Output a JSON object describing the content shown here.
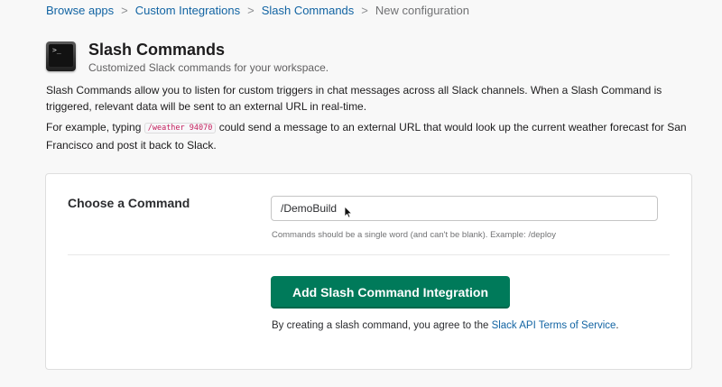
{
  "breadcrumb": {
    "items": [
      "Browse apps",
      "Custom Integrations",
      "Slash Commands"
    ],
    "current": "New configuration",
    "separator": ">"
  },
  "header": {
    "icon": "terminal-icon",
    "icon_text": ">_",
    "title": "Slash Commands",
    "subtitle": "Customized Slack commands for your workspace."
  },
  "description": {
    "paragraph1": "Slash Commands allow you to listen for custom triggers in chat messages across all Slack channels. When a Slash Command is triggered, relevant data will be sent to an external URL in real-time.",
    "paragraph2_prefix": "For example, typing ",
    "paragraph2_code": "/weather 94070",
    "paragraph2_suffix": " could send a message to an external URL that would look up the current weather forecast for San Francisco and post it back to Slack."
  },
  "form": {
    "label": "Choose a Command",
    "command_value": "/DemoBuild",
    "hint": "Commands should be a single word (and can't be blank). Example: /deploy",
    "submit_label": "Add Slash Command Integration",
    "terms_prefix": "By creating a slash command, you agree to the ",
    "terms_link": "Slack API Terms of Service",
    "terms_suffix": "."
  },
  "colors": {
    "link": "#1264a3",
    "primary_button": "#007a5a",
    "code": "#c41e5b"
  }
}
